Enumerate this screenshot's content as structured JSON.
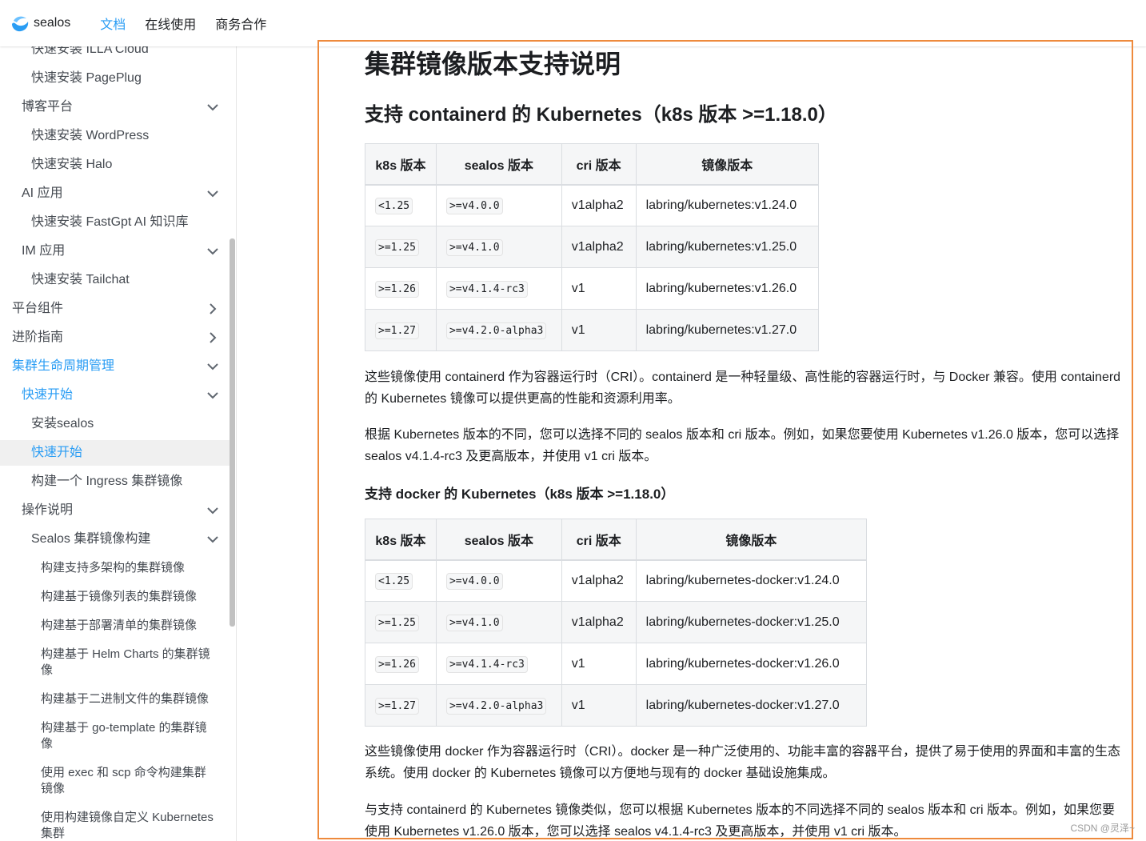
{
  "navbar": {
    "brand": "sealos",
    "links": [
      {
        "label": "文档",
        "active": true
      },
      {
        "label": "在线使用",
        "active": false
      },
      {
        "label": "商务合作",
        "active": false
      }
    ]
  },
  "sidebar": {
    "items": [
      {
        "label": "快速安装 ILLA Cloud"
      },
      {
        "label": "快速安装 PagePlug"
      },
      {
        "label": "博客平台"
      },
      {
        "label": "快速安装 WordPress"
      },
      {
        "label": "快速安装 Halo"
      },
      {
        "label": "AI 应用"
      },
      {
        "label": "快速安装 FastGpt AI 知识库"
      },
      {
        "label": "IM 应用"
      },
      {
        "label": "快速安装 Tailchat"
      },
      {
        "label": "平台组件"
      },
      {
        "label": "进阶指南"
      },
      {
        "label": "集群生命周期管理"
      },
      {
        "label": "快速开始"
      },
      {
        "label": "安装sealos"
      },
      {
        "label": "快速开始"
      },
      {
        "label": "构建一个 Ingress 集群镜像"
      },
      {
        "label": "操作说明"
      },
      {
        "label": "Sealos 集群镜像构建"
      },
      {
        "label": "构建支持多架构的集群镜像"
      },
      {
        "label": "构建基于镜像列表的集群镜像"
      },
      {
        "label": "构建基于部署清单的集群镜像"
      },
      {
        "label": "构建基于 Helm Charts 的集群镜像"
      },
      {
        "label": "构建基于二进制文件的集群镜像"
      },
      {
        "label": "构建基于 go-template 的集群镜像"
      },
      {
        "label": "使用 exec 和 scp 命令构建集群镜像"
      },
      {
        "label": "使用构建镜像自定义 Kubernetes 集群"
      }
    ]
  },
  "content": {
    "title": "集群镜像版本支持说明",
    "section1_title": "支持 containerd 的 Kubernetes（k8s 版本 >=1.18.0）",
    "table_headers": [
      "k8s 版本",
      "sealos 版本",
      "cri 版本",
      "镜像版本"
    ],
    "table1_rows": [
      [
        "<1.25",
        ">=v4.0.0",
        "v1alpha2",
        "labring/kubernetes:v1.24.0"
      ],
      [
        ">=1.25",
        ">=v4.1.0",
        "v1alpha2",
        "labring/kubernetes:v1.25.0"
      ],
      [
        ">=1.26",
        ">=v4.1.4-rc3",
        "v1",
        "labring/kubernetes:v1.26.0"
      ],
      [
        ">=1.27",
        ">=v4.2.0-alpha3",
        "v1",
        "labring/kubernetes:v1.27.0"
      ]
    ],
    "para1": "这些镜像使用 containerd 作为容器运行时（CRI）。containerd 是一种轻量级、高性能的容器运行时，与 Docker 兼容。使用 containerd 的 Kubernetes 镜像可以提供更高的性能和资源利用率。",
    "para2": "根据 Kubernetes 版本的不同，您可以选择不同的 sealos 版本和 cri 版本。例如，如果您要使用 Kubernetes v1.26.0 版本，您可以选择 sealos v4.1.4-rc3 及更高版本，并使用 v1 cri 版本。",
    "section2_title": "支持 docker 的 Kubernetes（k8s 版本 >=1.18.0）",
    "table2_rows": [
      [
        "<1.25",
        ">=v4.0.0",
        "v1alpha2",
        "labring/kubernetes-docker:v1.24.0"
      ],
      [
        ">=1.25",
        ">=v4.1.0",
        "v1alpha2",
        "labring/kubernetes-docker:v1.25.0"
      ],
      [
        ">=1.26",
        ">=v4.1.4-rc3",
        "v1",
        "labring/kubernetes-docker:v1.26.0"
      ],
      [
        ">=1.27",
        ">=v4.2.0-alpha3",
        "v1",
        "labring/kubernetes-docker:v1.27.0"
      ]
    ],
    "para3": "这些镜像使用 docker 作为容器运行时（CRI）。docker 是一种广泛使用的、功能丰富的容器平台，提供了易于使用的界面和丰富的生态系统。使用 docker 的 Kubernetes 镜像可以方便地与现有的 docker 基础设施集成。",
    "para4": "与支持 containerd 的 Kubernetes 镜像类似，您可以根据 Kubernetes 版本的不同选择不同的 sealos 版本和 cri 版本。例如，如果您要使用 Kubernetes v1.26.0 版本，您可以选择 sealos v4.1.4-rc3 及更高版本，并使用 v1 cri 版本。"
  },
  "watermark": "CSDN @灵泽~",
  "colors": {
    "accent": "#2a9df4",
    "highlight_border": "#ee8a3c"
  }
}
